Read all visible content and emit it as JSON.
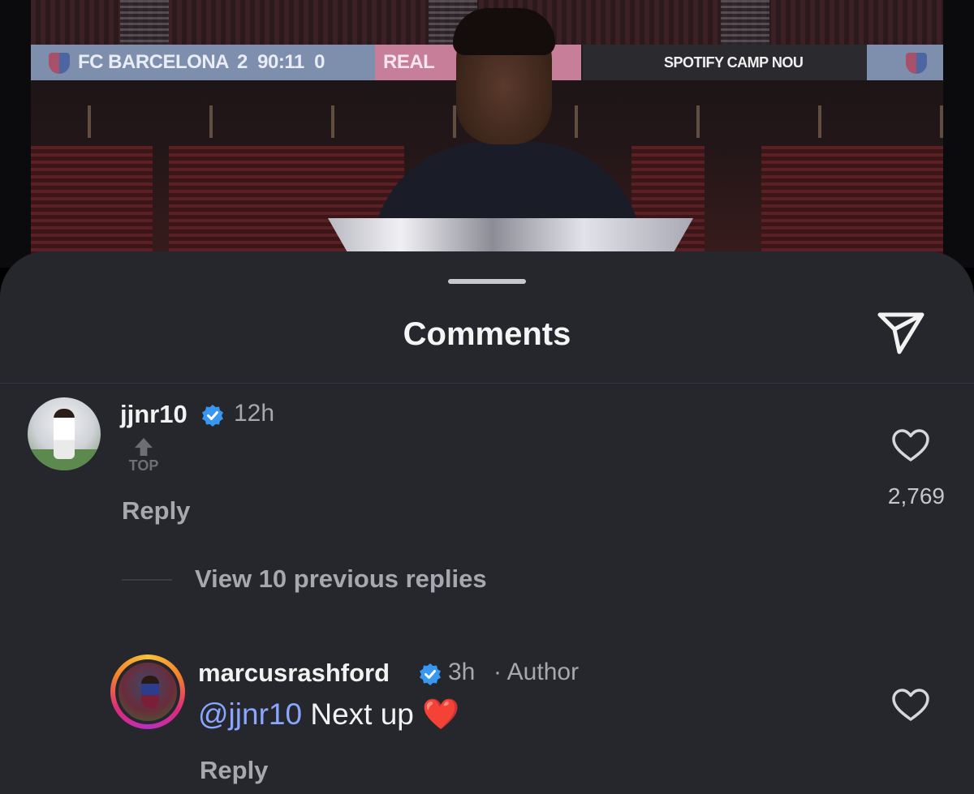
{
  "photo": {
    "scoreboard": {
      "home_team": "FC BARCELONA",
      "score": "2  90:11  0",
      "away_team": "REAL",
      "sponsor": "SPOTIFY CAMP NOU"
    }
  },
  "sheet": {
    "title": "Comments",
    "share_icon": "paper-plane-icon"
  },
  "comments": [
    {
      "username": "jjnr10",
      "verified": true,
      "time": "12h",
      "badge": "TOP",
      "reply_label": "Reply",
      "like_count": "2,769"
    }
  ],
  "view_replies": "View 10 previous replies",
  "replies": [
    {
      "username": "marcusrashford",
      "verified": true,
      "time": "3h",
      "author_tag": "· Author",
      "mention": "@jjnr10",
      "text": "Next up",
      "emoji": "❤️",
      "reply_label": "Reply"
    }
  ],
  "colors": {
    "sheet_bg": "#25272d",
    "verified_blue": "#3897f0",
    "mention_blue": "#8aa6ff"
  }
}
